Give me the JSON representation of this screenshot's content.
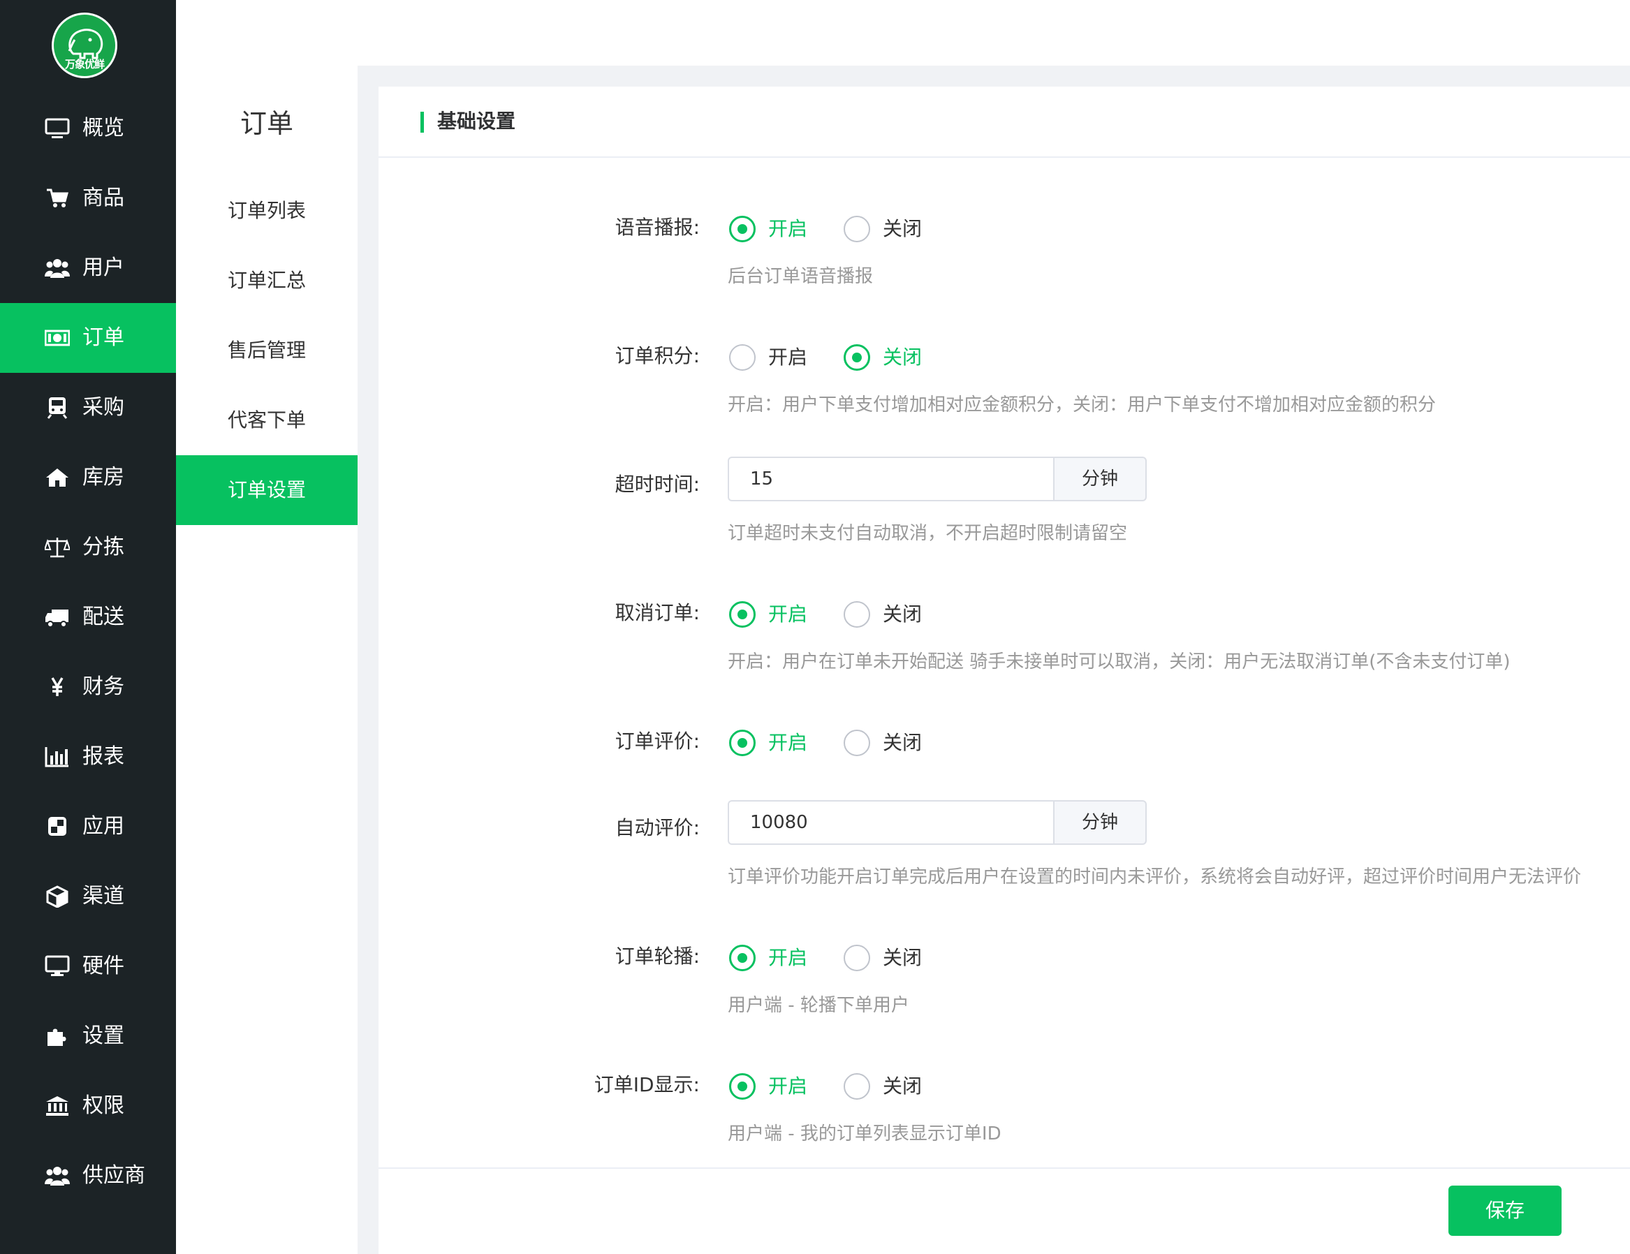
{
  "brand": {
    "logo_text": "万象优鲜",
    "accent": "#07c160",
    "sidebar_bg": "#1c2326"
  },
  "sidebar": {
    "items": [
      {
        "label": "概览",
        "icon": "monitor-icon"
      },
      {
        "label": "商品",
        "icon": "cart-icon"
      },
      {
        "label": "用户",
        "icon": "users-icon"
      },
      {
        "label": "订单",
        "icon": "money-icon",
        "active": true
      },
      {
        "label": "采购",
        "icon": "train-icon"
      },
      {
        "label": "库房",
        "icon": "home-icon"
      },
      {
        "label": "分拣",
        "icon": "balance-scale-icon"
      },
      {
        "label": "配送",
        "icon": "truck-icon"
      },
      {
        "label": "财务",
        "icon": "yen-icon"
      },
      {
        "label": "报表",
        "icon": "bar-chart-icon"
      },
      {
        "label": "应用",
        "icon": "app-icon"
      },
      {
        "label": "渠道",
        "icon": "cube-icon"
      },
      {
        "label": "硬件",
        "icon": "desktop-icon"
      },
      {
        "label": "设置",
        "icon": "puzzle-icon"
      },
      {
        "label": "权限",
        "icon": "bank-icon"
      },
      {
        "label": "供应商",
        "icon": "group-icon"
      }
    ]
  },
  "subnav": {
    "title": "订单",
    "items": [
      {
        "label": "订单列表"
      },
      {
        "label": "订单汇总"
      },
      {
        "label": "售后管理"
      },
      {
        "label": "代客下单"
      },
      {
        "label": "订单设置",
        "active": true
      }
    ]
  },
  "section": {
    "title": "基础设置"
  },
  "form": {
    "voice_broadcast": {
      "label": "语音播报:",
      "options": [
        "开启",
        "关闭"
      ],
      "selected": "开启",
      "help": "后台订单语音播报"
    },
    "order_points": {
      "label": "订单积分:",
      "options": [
        "开启",
        "关闭"
      ],
      "selected": "关闭",
      "help": "开启：用户下单支付增加相对应金额积分，关闭：用户下单支付不增加相对应金额的积分"
    },
    "timeout": {
      "label": "超时时间:",
      "value": "15",
      "suffix": "分钟",
      "help": "订单超时未支付自动取消，不开启超时限制请留空"
    },
    "cancel_order": {
      "label": "取消订单:",
      "options": [
        "开启",
        "关闭"
      ],
      "selected": "开启",
      "help": "开启：用户在订单未开始配送 骑手未接单时可以取消，关闭：用户无法取消订单(不含未支付订单)"
    },
    "order_review": {
      "label": "订单评价:",
      "options": [
        "开启",
        "关闭"
      ],
      "selected": "开启"
    },
    "auto_review": {
      "label": "自动评价:",
      "value": "10080",
      "suffix": "分钟",
      "help": "订单评价功能开启订单完成后用户在设置的时间内未评价，系统将会自动好评，超过评价时间用户无法评价"
    },
    "order_carousel": {
      "label": "订单轮播:",
      "options": [
        "开启",
        "关闭"
      ],
      "selected": "开启",
      "help": "用户端 - 轮播下单用户"
    },
    "order_id_display": {
      "label": "订单ID显示:",
      "options": [
        "开启",
        "关闭"
      ],
      "selected": "开启",
      "help": "用户端 - 我的订单列表显示订单ID"
    }
  },
  "actions": {
    "save_label": "保存"
  }
}
